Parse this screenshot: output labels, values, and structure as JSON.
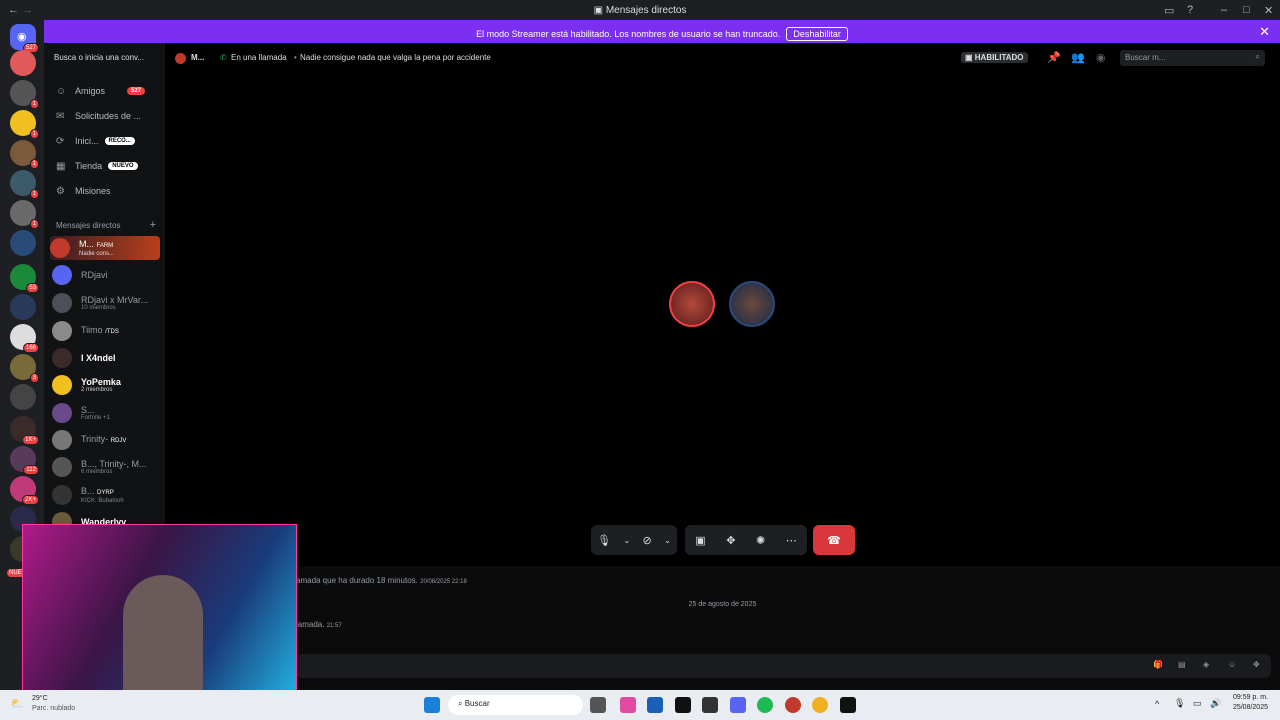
{
  "window": {
    "title": "Mensajes directos"
  },
  "banner": {
    "message": "El modo Streamer está habilitado. Los nombres de usuario se han truncado.",
    "button": "Deshabilitar"
  },
  "servers": {
    "home_badge": "527",
    "badges": [
      "1",
      "1",
      "1",
      "1",
      "1",
      "53",
      "166",
      "3",
      "1K+",
      "112",
      "2K+",
      "NUEVO"
    ]
  },
  "sidebar": {
    "search_placeholder": "Busca o inicia una conv...",
    "nav": [
      {
        "label": "Amigos",
        "pill": "527"
      },
      {
        "label": "Solicitudes de ...",
        "pill": ""
      },
      {
        "label": "Inici...",
        "pill": "RECO..."
      },
      {
        "label": "Tienda",
        "pill": "NUEVO"
      },
      {
        "label": "Misiones",
        "pill": ""
      }
    ],
    "dm_header": "Mensajes directos",
    "dms": [
      {
        "name": "M...",
        "tag": "FARM",
        "sub": "Nadie cons..."
      },
      {
        "name": "RDjavi",
        "tag": "",
        "sub": ""
      },
      {
        "name": "RDjavi x MrVar...",
        "tag": "",
        "sub": "10 miembros"
      },
      {
        "name": "Tiimo",
        "tag": "/TDS",
        "sub": ""
      },
      {
        "name": "I X4ndel",
        "tag": "",
        "sub": ""
      },
      {
        "name": "YoPemka",
        "tag": "",
        "sub": "2 miembros"
      },
      {
        "name": "S...",
        "tag": "",
        "sub": "Fortnite +1"
      },
      {
        "name": "Trinity-",
        "tag": "RDJV",
        "sub": ""
      },
      {
        "name": "B..., Trinity-, M...",
        "tag": "",
        "sub": "6 miembros"
      },
      {
        "name": "B...",
        "tag": "DYRP",
        "sub": "KICK: Bubalooh"
      },
      {
        "name": "Wanderlyy",
        "tag": "",
        "sub": ""
      }
    ]
  },
  "topbar": {
    "channel": "M...",
    "call_status": "En una llamada",
    "topic": "Nadie consigue nada que valga la pena por accidente",
    "streamer_badge": "HABILITADO",
    "search_placeholder": "Buscar m..."
  },
  "chat": {
    "msg1": "amada que ha durado 18 minutos.",
    "msg1_time": "20/08/2025 22:18",
    "date_divider": "25 de agosto de 2025",
    "msg2": "lamada.",
    "msg2_time": "21:57"
  },
  "taskbar": {
    "weather_temp": "29°C",
    "weather_desc": "Parc. nublado",
    "search": "Buscar",
    "time": "09:59 p. m.",
    "date": "25/08/2025"
  }
}
